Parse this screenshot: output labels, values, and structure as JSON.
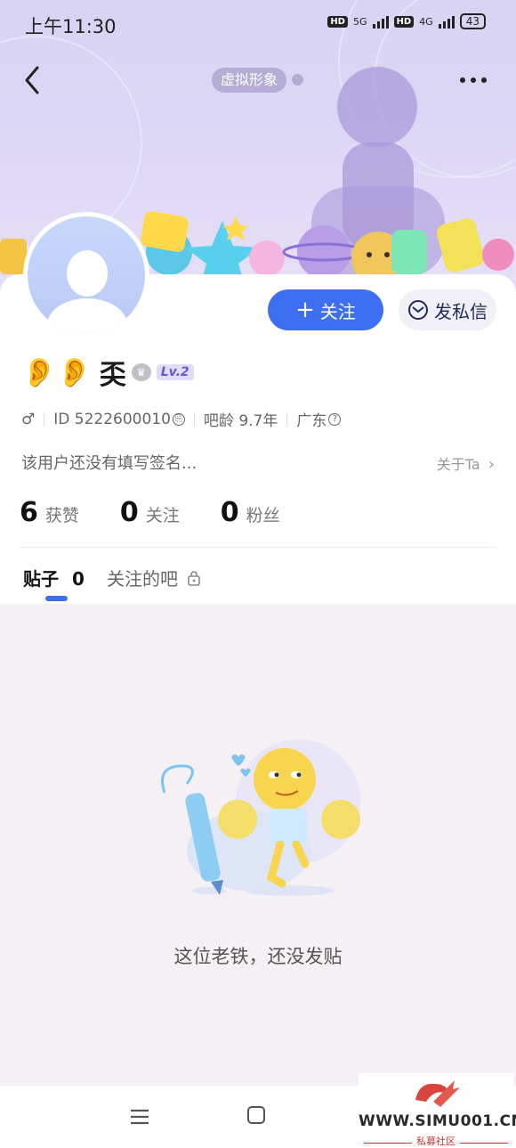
{
  "status_bar": {
    "time": "上午11:30",
    "hd1": "HD",
    "net1": "5G",
    "hd2": "HD",
    "net2": "4G",
    "battery": "43"
  },
  "header": {
    "virtual_avatar_label": "虚拟形象",
    "back_icon": "chevron-left-icon",
    "more_icon": "more-dots-icon"
  },
  "actions": {
    "follow_label": "关注",
    "follow_prefix": "+",
    "message_label": "发私信"
  },
  "profile": {
    "name_emoji": "👂👂",
    "name": "奀",
    "level": "Lv.2",
    "gender": "♂",
    "id_text": "ID 5222600010",
    "bar_age": "吧龄 9.7年",
    "region": "广东",
    "signature": "该用户还没有填写签名...",
    "about_label": "关于Ta"
  },
  "stats": [
    {
      "value": "6",
      "label": "获赞"
    },
    {
      "value": "0",
      "label": "关注"
    },
    {
      "value": "0",
      "label": "粉丝"
    }
  ],
  "tabs": {
    "posts_label": "贴子",
    "posts_count": "0",
    "followed_bars_label": "关注的吧"
  },
  "empty_state": {
    "text": "这位老铁，还没发贴"
  },
  "watermark": {
    "url": "WWW.SIMU001.CN",
    "cn": "私募社区"
  },
  "colors": {
    "accent": "#3d6ff0",
    "banner": "#ddd7f6",
    "background": "#f4f0f4"
  }
}
